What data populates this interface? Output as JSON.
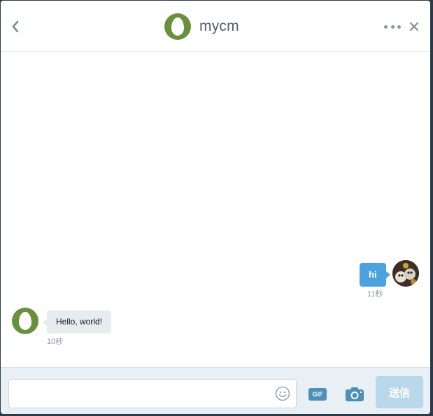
{
  "header": {
    "title": "mycm",
    "back_icon": "chevron-left-icon",
    "more_icon": "more-horizontal-icon",
    "close_icon": "close-icon"
  },
  "messages": [
    {
      "direction": "outgoing",
      "text": "hi",
      "time": "11秒"
    },
    {
      "direction": "incoming",
      "text": "Hello, world!",
      "time": "10秒"
    }
  ],
  "composer": {
    "input_value": "",
    "input_placeholder": "",
    "gif_label": "GIF",
    "send_label": "送信"
  },
  "colors": {
    "accent_blue": "#4aa3df",
    "egg_avatar_green": "#6a8f3d",
    "send_button_disabled": "#b9d8ea",
    "composer_background": "#e8eff5"
  }
}
